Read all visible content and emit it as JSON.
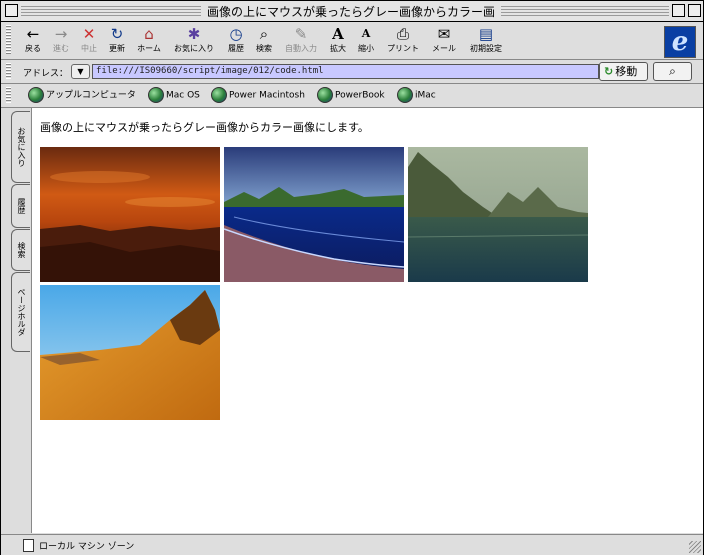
{
  "window": {
    "title": "画像の上にマウスが乗ったらグレー画像からカラー画"
  },
  "toolbar": {
    "buttons": [
      {
        "label": "戻る",
        "icon": "←"
      },
      {
        "label": "進む",
        "icon": "→"
      },
      {
        "label": "中止",
        "icon": "✕"
      },
      {
        "label": "更新",
        "icon": "↻"
      },
      {
        "label": "ホーム",
        "icon": "⌂"
      },
      {
        "label": "お気に入り",
        "icon": "✱"
      },
      {
        "label": "履歴",
        "icon": "◷"
      },
      {
        "label": "検索",
        "icon": "⌕"
      },
      {
        "label": "自動入力",
        "icon": "✎"
      },
      {
        "label": "拡大",
        "icon": "A"
      },
      {
        "label": "縮小",
        "icon": "A"
      },
      {
        "label": "プリント",
        "icon": "⎙"
      },
      {
        "label": "メール",
        "icon": "✉"
      },
      {
        "label": "初期設定",
        "icon": "▤"
      }
    ],
    "logo": "e"
  },
  "address": {
    "label": "アドレス：",
    "url": "file:///IS09660/script/image/012/code.html",
    "go_label": "移動"
  },
  "favorites": [
    "アップルコンピュータ",
    "Mac OS",
    "Power Macintosh",
    "PowerBook",
    "iMac"
  ],
  "side_tabs": [
    "お気に入り",
    "履歴",
    "検索",
    "ページホルダ"
  ],
  "content": {
    "message": "画像の上にマウスが乗ったらグレー画像からカラー画像にします。"
  },
  "status": {
    "zone": "ローカル マシン ゾーン"
  }
}
